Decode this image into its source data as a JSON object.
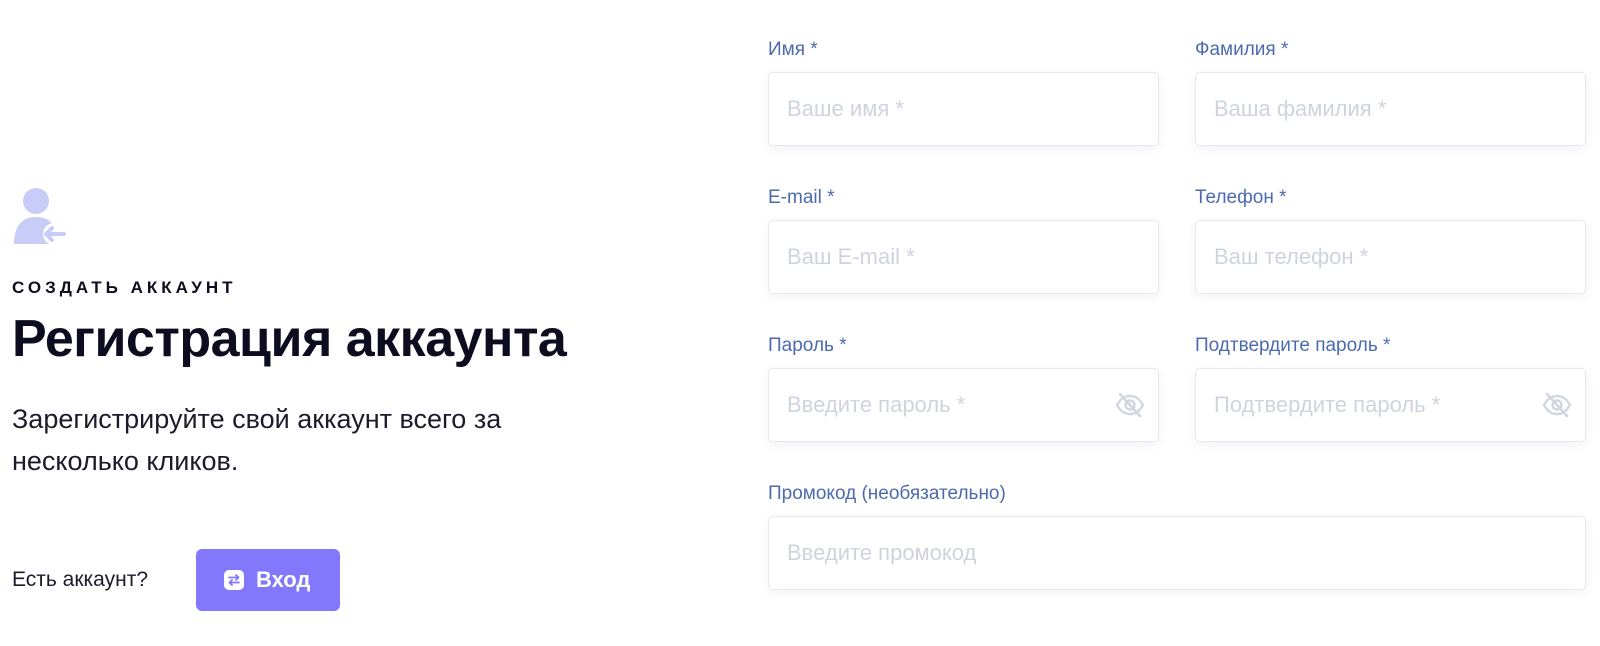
{
  "intro": {
    "icon": "user-login-icon",
    "eyebrow": "СОЗДАТЬ АККАУНТ",
    "title": "Регистрация аккаунта",
    "lead": "Зарегистрируйте свой аккаунт всего за несколько кликов.",
    "has_account": "Есть аккаунт?",
    "login_button": "Вход",
    "login_button_icon": "swap-icon"
  },
  "form": {
    "first_name": {
      "label": "Имя *",
      "placeholder": "Ваше имя *"
    },
    "last_name": {
      "label": "Фамилия *",
      "placeholder": "Ваша фамилия *"
    },
    "email": {
      "label": "E-mail *",
      "placeholder": "Ваш E-mail *"
    },
    "phone": {
      "label": "Телефон *",
      "placeholder": "Ваш телефон *"
    },
    "password": {
      "label": "Пароль *",
      "placeholder": "Введите пароль *",
      "toggle_icon": "eye-off-icon"
    },
    "password_confirm": {
      "label": "Подтвердите пароль *",
      "placeholder": "Подтвердите пароль *",
      "toggle_icon": "eye-off-icon"
    },
    "promo": {
      "label": "Промокод (необязательно)",
      "placeholder": "Введите промокод"
    }
  },
  "colors": {
    "accent": "#8378fb",
    "label": "#4c6bae",
    "heading": "#0e0d1f",
    "icon_light": "#c9ccf7",
    "placeholder": "#cfd3dd"
  }
}
